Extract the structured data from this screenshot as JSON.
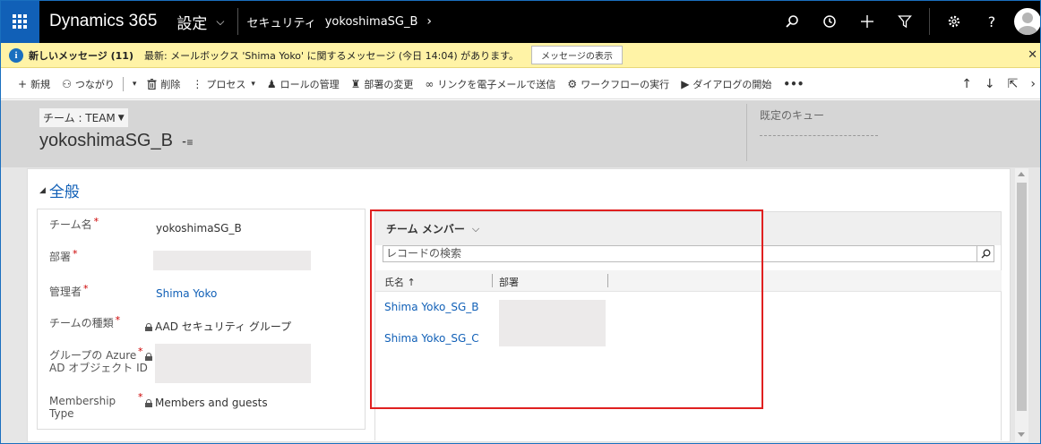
{
  "topnav": {
    "brand": "Dynamics 365",
    "area": "設定",
    "breadcrumb": "セキュリティ",
    "entity": "yokoshimaSG_B"
  },
  "notification": {
    "title": "新しいメッセージ (11)",
    "text": "最新: メールボックス 'Shima Yoko' に関するメッセージ (今日 14:04) があります。",
    "button": "メッセージの表示"
  },
  "commands": [
    {
      "icon": "plus-icon",
      "label": "新規"
    },
    {
      "icon": "connect-icon",
      "label": "つながり"
    },
    {
      "icon": "delete-icon",
      "label": "削除"
    },
    {
      "icon": "process-icon",
      "label": "プロセス"
    },
    {
      "icon": "role-icon",
      "label": "ロールの管理"
    },
    {
      "icon": "business-unit-icon",
      "label": "部署の変更"
    },
    {
      "icon": "link-icon",
      "label": "リンクを電子メールで送信"
    },
    {
      "icon": "workflow-icon",
      "label": "ワークフローの実行"
    },
    {
      "icon": "dialog-icon",
      "label": "ダイアログの開始"
    }
  ],
  "header": {
    "entity_type": "チーム : TEAM",
    "record_name": "yokoshimaSG_B",
    "queue_label": "既定のキュー"
  },
  "section": {
    "title": "全般"
  },
  "fields": {
    "team_name": {
      "label": "チーム名",
      "value": "yokoshimaSG_B"
    },
    "business_unit": {
      "label": "部署",
      "value": ""
    },
    "administrator": {
      "label": "管理者",
      "value": "Shima Yoko"
    },
    "team_type": {
      "label": "チームの種類",
      "value": "AAD セキュリティ グループ"
    },
    "azure_id": {
      "label_line1": "グループの Azure",
      "label_line2": "AD オブジェクト ID",
      "value": ""
    },
    "membership": {
      "label_line1": "Membership",
      "label_line2": "Type",
      "value": "Members and guests"
    }
  },
  "subgrid": {
    "title": "チーム メンバー",
    "search_placeholder": "レコードの検索",
    "columns": [
      "氏名 ↑",
      "部署"
    ],
    "rows": [
      "Shima Yoko_SG_B",
      "Shima Yoko_SG_C"
    ]
  },
  "colors": {
    "accent": "#1160b7",
    "nav_bg": "#000000",
    "notification_bg": "#fff3a6",
    "highlight": "#e02020"
  }
}
